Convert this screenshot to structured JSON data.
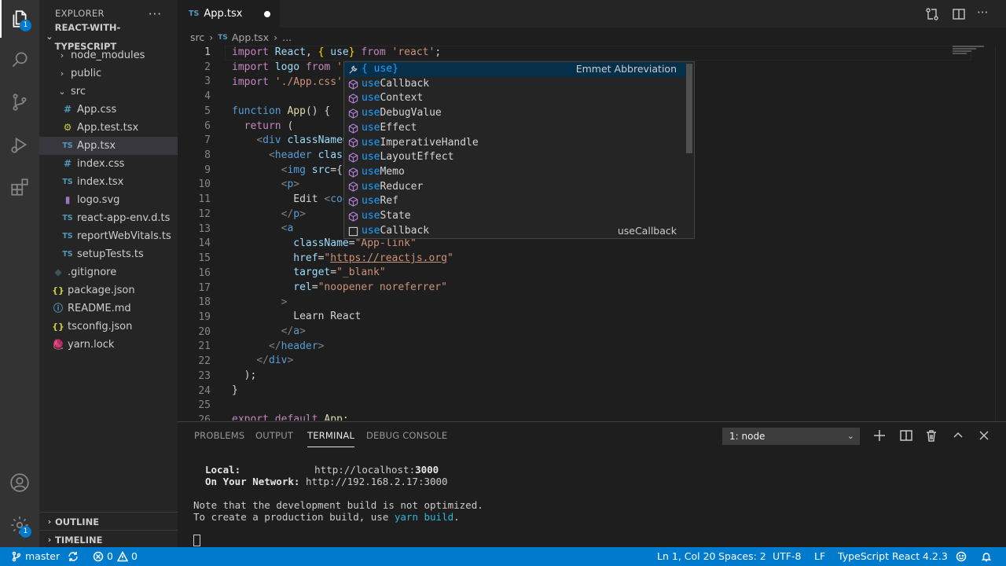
{
  "activity_bar": {
    "explorer_badge": "1",
    "settings_badge": "1"
  },
  "sidebar": {
    "title": "EXPLORER",
    "more": "···",
    "project": "REACT-WITH-TYPESCRIPT",
    "tree": [
      {
        "label": "node_modules",
        "type": "folder",
        "expanded": false
      },
      {
        "label": "public",
        "type": "folder",
        "expanded": false
      },
      {
        "label": "src",
        "type": "folder",
        "expanded": true
      },
      {
        "label": "App.css",
        "icon": "#"
      },
      {
        "label": "App.test.tsx",
        "icon": "⚙"
      },
      {
        "label": "App.tsx",
        "icon": "TS",
        "selected": true
      },
      {
        "label": "index.css",
        "icon": "#"
      },
      {
        "label": "index.tsx",
        "icon": "TS"
      },
      {
        "label": "logo.svg",
        "icon": "▮"
      },
      {
        "label": "react-app-env.d.ts",
        "icon": "TS"
      },
      {
        "label": "reportWebVitals.ts",
        "icon": "TS"
      },
      {
        "label": "setupTests.ts",
        "icon": "TS"
      },
      {
        "label": ".gitignore",
        "icon": "◆"
      },
      {
        "label": "package.json",
        "icon": "{}"
      },
      {
        "label": "README.md",
        "icon": "ⓘ"
      },
      {
        "label": "tsconfig.json",
        "icon": "{}"
      },
      {
        "label": "yarn.lock",
        "icon": "🧶"
      }
    ],
    "outline": "OUTLINE",
    "timeline": "TIMELINE"
  },
  "tab": {
    "icon": "TS",
    "label": "App.tsx"
  },
  "breadcrumb": {
    "folder": "src",
    "icon": "TS",
    "file": "App.tsx",
    "more": "..."
  },
  "editor": {
    "line_numbers": [
      "1",
      "2",
      "3",
      "4",
      "5",
      "6",
      "7",
      "8",
      "9",
      "10",
      "11",
      "12",
      "13",
      "14",
      "15",
      "16",
      "17",
      "18",
      "19",
      "20",
      "21",
      "22",
      "23",
      "24",
      "25",
      "26"
    ]
  },
  "suggest": {
    "items": [
      {
        "match": "{ use",
        "rest": "}",
        "detail": "Emmet Abbreviation",
        "kind": "emmet"
      },
      {
        "match": "use",
        "rest": "Callback",
        "detail": "",
        "kind": "fn"
      },
      {
        "match": "use",
        "rest": "Context",
        "detail": "",
        "kind": "fn"
      },
      {
        "match": "use",
        "rest": "DebugValue",
        "detail": "",
        "kind": "fn"
      },
      {
        "match": "use",
        "rest": "Effect",
        "detail": "",
        "kind": "fn"
      },
      {
        "match": "use",
        "rest": "ImperativeHandle",
        "detail": "",
        "kind": "fn"
      },
      {
        "match": "use",
        "rest": "LayoutEffect",
        "detail": "",
        "kind": "fn"
      },
      {
        "match": "use",
        "rest": "Memo",
        "detail": "",
        "kind": "fn"
      },
      {
        "match": "use",
        "rest": "Reducer",
        "detail": "",
        "kind": "fn"
      },
      {
        "match": "use",
        "rest": "Ref",
        "detail": "",
        "kind": "fn"
      },
      {
        "match": "use",
        "rest": "State",
        "detail": "",
        "kind": "fn"
      },
      {
        "match": "use",
        "rest": "Callback",
        "detail": "useCallback",
        "kind": "word"
      }
    ]
  },
  "panel": {
    "tabs": [
      "PROBLEMS",
      "OUTPUT",
      "TERMINAL",
      "DEBUG CONSOLE"
    ],
    "active_tab": "TERMINAL",
    "terminal_select": "1: node",
    "terminal": {
      "local_label": "Local:",
      "local_url_prefix": "http://localhost:",
      "local_port": "3000",
      "network_label": "On Your Network:",
      "network_url": "http://192.168.2.17:3000",
      "note1": "Note that the development build is not optimized.",
      "note2_prefix": "To create a production build, use ",
      "note2_cmd": "yarn build",
      "note2_suffix": "."
    }
  },
  "status_bar": {
    "branch": "master",
    "errors": "0",
    "warnings": "0",
    "position": "Ln 1, Col 20",
    "spaces": "Spaces: 2",
    "encoding": "UTF-8",
    "eol": "LF",
    "language": "TypeScript React",
    "version": "4.2.3"
  },
  "colors": {
    "accent": "#007acc",
    "match_highlight": "#18a3ff",
    "selected_suggestion": "#062f4a"
  }
}
